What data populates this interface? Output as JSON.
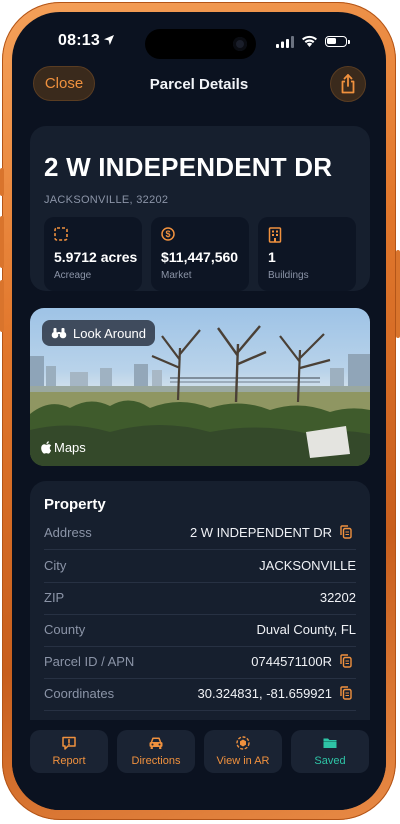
{
  "status_bar": {
    "time": "08:13"
  },
  "nav": {
    "close_label": "Close",
    "title": "Parcel Details"
  },
  "header": {
    "address": "2 W INDEPENDENT DR",
    "city_zip": "JACKSONVILLE, 32202",
    "stats": [
      {
        "value": "5.9712 acres",
        "label": "Acreage",
        "icon": "dashed-square-icon"
      },
      {
        "value": "$11,447,560",
        "label": "Market",
        "icon": "dollar-circle-icon"
      },
      {
        "value": "1",
        "label": "Buildings",
        "icon": "building-icon"
      }
    ]
  },
  "look_around": {
    "label": "Look Around",
    "maps_label": "Maps"
  },
  "property": {
    "title": "Property",
    "rows": [
      {
        "label": "Address",
        "value": "2 W INDEPENDENT DR",
        "copyable": true
      },
      {
        "label": "City",
        "value": "JACKSONVILLE",
        "copyable": false
      },
      {
        "label": "ZIP",
        "value": "32202",
        "copyable": false
      },
      {
        "label": "County",
        "value": "Duval County, FL",
        "copyable": false
      },
      {
        "label": "Parcel ID / APN",
        "value": "0744571100R",
        "copyable": true
      },
      {
        "label": "Coordinates",
        "value": "30.324831, -81.659921",
        "copyable": true
      }
    ]
  },
  "tabs": [
    {
      "label": "Report",
      "icon": "report-icon"
    },
    {
      "label": "Directions",
      "icon": "car-icon"
    },
    {
      "label": "View in AR",
      "icon": "ar-icon"
    },
    {
      "label": "Saved",
      "icon": "folder-icon"
    }
  ],
  "colors": {
    "accent": "#f0913e",
    "saved": "#2ec4a6",
    "background": "#0b1220",
    "card": "#161f2e"
  }
}
